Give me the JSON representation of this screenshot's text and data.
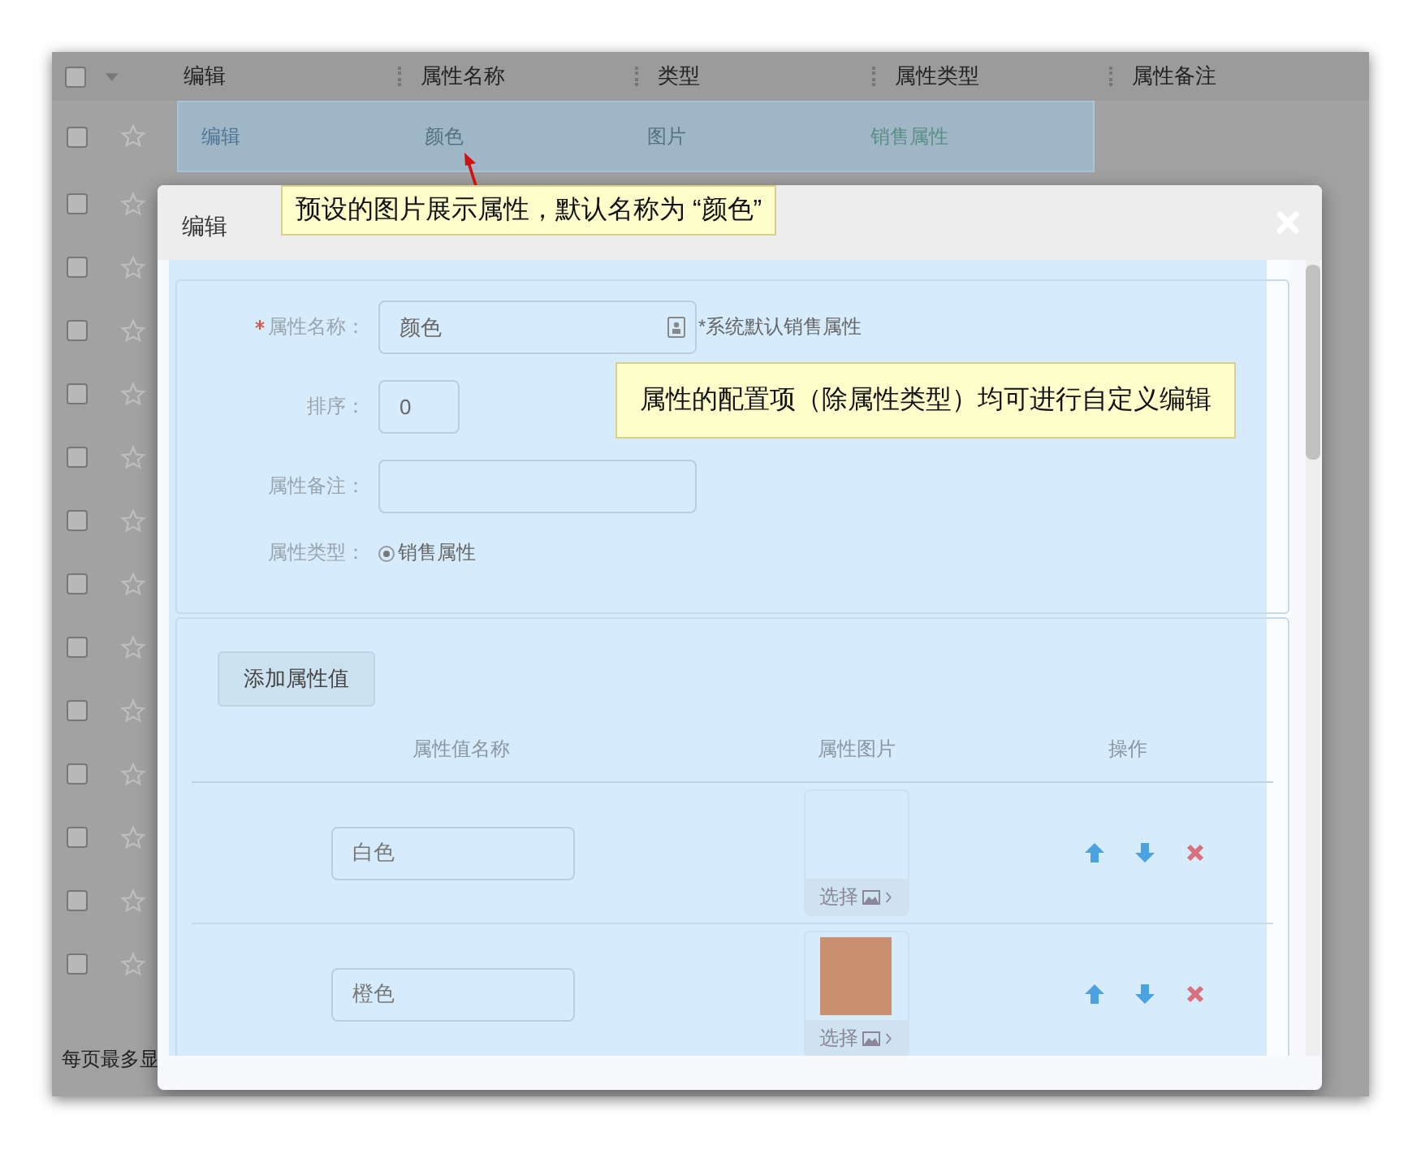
{
  "table": {
    "select_all": {
      "checked": false
    },
    "columns": [
      "编辑",
      "属性名称",
      "类型",
      "属性类型",
      "属性备注"
    ],
    "rows": [
      {
        "checked": false,
        "starred": false,
        "selected": true,
        "cells": [
          "编辑",
          "颜色",
          "图片",
          "销售属性"
        ]
      },
      {
        "checked": false,
        "starred": false
      },
      {
        "checked": false,
        "starred": false
      },
      {
        "checked": false,
        "starred": false
      },
      {
        "checked": false,
        "starred": false
      },
      {
        "checked": false,
        "starred": false
      },
      {
        "checked": false,
        "starred": false
      },
      {
        "checked": false,
        "starred": false
      },
      {
        "checked": false,
        "starred": false
      },
      {
        "checked": false,
        "starred": false
      },
      {
        "checked": false,
        "starred": false
      },
      {
        "checked": false,
        "starred": false
      },
      {
        "checked": false,
        "starred": false
      },
      {
        "checked": false,
        "starred": false
      }
    ]
  },
  "footer": {
    "text": "每页最多显"
  },
  "dialog": {
    "title": "编辑",
    "fields": [
      {
        "kind": "text",
        "label": "属性名称：",
        "required": true,
        "value": "颜色",
        "note": "*系统默认销售属性"
      },
      {
        "kind": "number",
        "label": "排序：",
        "required": false,
        "value": "0"
      },
      {
        "kind": "text",
        "label": "属性备注：",
        "required": false
      },
      {
        "kind": "radio",
        "label": "属性类型：",
        "required": false,
        "options": [
          {
            "label": "销售属性",
            "selected": true
          }
        ]
      }
    ],
    "add_button": "添加属性值",
    "values": {
      "columns": [
        "属性值名称",
        "属性图片",
        "操作"
      ],
      "rows": [
        {
          "name": "白色",
          "pick_label": "选择"
        },
        {
          "name": "橙色",
          "pick_label": "选择",
          "color": "#c8906e"
        }
      ]
    }
  },
  "annotations": [
    {
      "text": "预设的图片展示属性，默认名称为 “颜色”"
    },
    {
      "text": "属性的配置项（除属性类型）均可进行自定义编辑"
    }
  ]
}
